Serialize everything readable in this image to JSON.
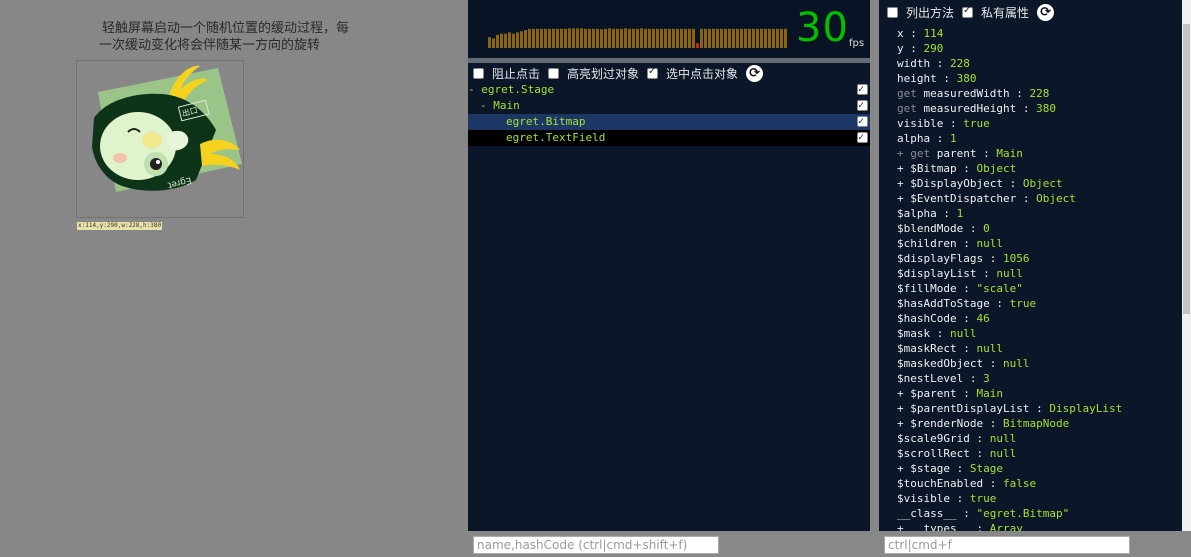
{
  "stage": {
    "description_lines": [
      "轻触屏幕启动一个随机位置的缓动过程，每",
      "一次缓动变化将会伴随某一方向的旋转"
    ],
    "bounds_label": "x:114,y:290,w:228,h:380",
    "bitmap_text": [
      "出口",
      "Egret"
    ]
  },
  "fps": {
    "value": "30",
    "unit": "fps",
    "history": [
      0.45,
      0.4,
      0.55,
      0.6,
      0.6,
      0.65,
      0.6,
      0.65,
      0.7,
      0.75,
      0.8,
      0.8,
      0.8,
      0.8,
      0.8,
      0.8,
      0.8,
      0.8,
      0.8,
      0.8,
      0.82,
      0.82,
      0.82,
      0.82,
      0.8,
      0.8,
      0.8,
      0.8,
      0.78,
      0.8,
      0.82,
      0.8,
      0.8,
      0.8,
      0.82,
      0.8,
      0.8,
      0.8,
      0.82,
      0.8,
      0.8,
      0.8,
      0.8,
      0.8,
      0.8,
      0.8,
      0.8,
      0.8,
      0.8,
      0.8,
      0.8,
      0.8,
      0.2,
      0.8,
      0.8,
      0.8,
      0.8,
      0.8,
      0.8,
      0.8,
      0.8,
      0.8,
      0.8,
      0.8,
      0.8,
      0.8,
      0.8,
      0.8,
      0.8,
      0.8,
      0.8,
      0.8,
      0.8,
      0.8,
      0.8,
      0.8,
      0.8,
      0.8
    ],
    "bar_colors": {
      "normal": "#8c6410",
      "low": "#cc2a10"
    }
  },
  "mid_options": [
    {
      "label": "阻止点击",
      "checked": false
    },
    {
      "label": "高亮划过对象",
      "checked": false
    },
    {
      "label": "选中点击对象",
      "checked": true
    }
  ],
  "tree": [
    {
      "text": "- egret.Stage",
      "depth": 0,
      "state": "normal"
    },
    {
      "text": "- Main",
      "depth": 1,
      "state": "normal"
    },
    {
      "text": "egret.Bitmap",
      "depth": 2,
      "state": "selected"
    },
    {
      "text": "egret.TextField",
      "depth": 2,
      "state": "hover"
    }
  ],
  "mid_search": {
    "placeholder": "name,hashCode (ctrl|cmd+shift+f)"
  },
  "right_options": [
    {
      "label": "列出方法",
      "checked": false
    },
    {
      "label": "私有属性",
      "checked": true
    }
  ],
  "properties": [
    {
      "pre": "",
      "key": "x",
      "value": "114"
    },
    {
      "pre": "",
      "key": "y",
      "value": "290"
    },
    {
      "pre": "",
      "key": "width",
      "value": "228"
    },
    {
      "pre": "",
      "key": "height",
      "value": "380"
    },
    {
      "pre": "get ",
      "key": "measuredWidth",
      "value": "228"
    },
    {
      "pre": "get ",
      "key": "measuredHeight",
      "value": "380"
    },
    {
      "pre": "",
      "key": "visible",
      "value": "true"
    },
    {
      "pre": "",
      "key": "alpha",
      "value": "1"
    },
    {
      "pre": "+ get ",
      "key": "parent",
      "value": "Main"
    },
    {
      "pre": "+ ",
      "key": "$Bitmap",
      "value": "Object"
    },
    {
      "pre": "+ ",
      "key": "$DisplayObject",
      "value": "Object"
    },
    {
      "pre": "+ ",
      "key": "$EventDispatcher",
      "value": "Object"
    },
    {
      "pre": "",
      "key": "$alpha",
      "value": "1"
    },
    {
      "pre": "",
      "key": "$blendMode",
      "value": "0"
    },
    {
      "pre": "",
      "key": "$children",
      "value": "null"
    },
    {
      "pre": "",
      "key": "$displayFlags",
      "value": "1056"
    },
    {
      "pre": "",
      "key": "$displayList",
      "value": "null"
    },
    {
      "pre": "",
      "key": "$fillMode",
      "value": "\"scale\""
    },
    {
      "pre": "",
      "key": "$hasAddToStage",
      "value": "true"
    },
    {
      "pre": "",
      "key": "$hashCode",
      "value": "46"
    },
    {
      "pre": "",
      "key": "$mask",
      "value": "null"
    },
    {
      "pre": "",
      "key": "$maskRect",
      "value": "null"
    },
    {
      "pre": "",
      "key": "$maskedObject",
      "value": "null"
    },
    {
      "pre": "",
      "key": "$nestLevel",
      "value": "3"
    },
    {
      "pre": "+ ",
      "key": "$parent",
      "value": "Main"
    },
    {
      "pre": "+ ",
      "key": "$parentDisplayList",
      "value": "DisplayList"
    },
    {
      "pre": "+ ",
      "key": "$renderNode",
      "value": "BitmapNode"
    },
    {
      "pre": "",
      "key": "$scale9Grid",
      "value": "null"
    },
    {
      "pre": "",
      "key": "$scrollRect",
      "value": "null"
    },
    {
      "pre": "+ ",
      "key": "$stage",
      "value": "Stage"
    },
    {
      "pre": "",
      "key": "$touchEnabled",
      "value": "false"
    },
    {
      "pre": "",
      "key": "$visible",
      "value": "true"
    },
    {
      "pre": "",
      "key": "__class__",
      "value": "\"egret.Bitmap\""
    },
    {
      "pre": "+ ",
      "key": "__types__",
      "value": "Array"
    }
  ],
  "right_search": {
    "placeholder": "ctrl|cmd+f"
  }
}
